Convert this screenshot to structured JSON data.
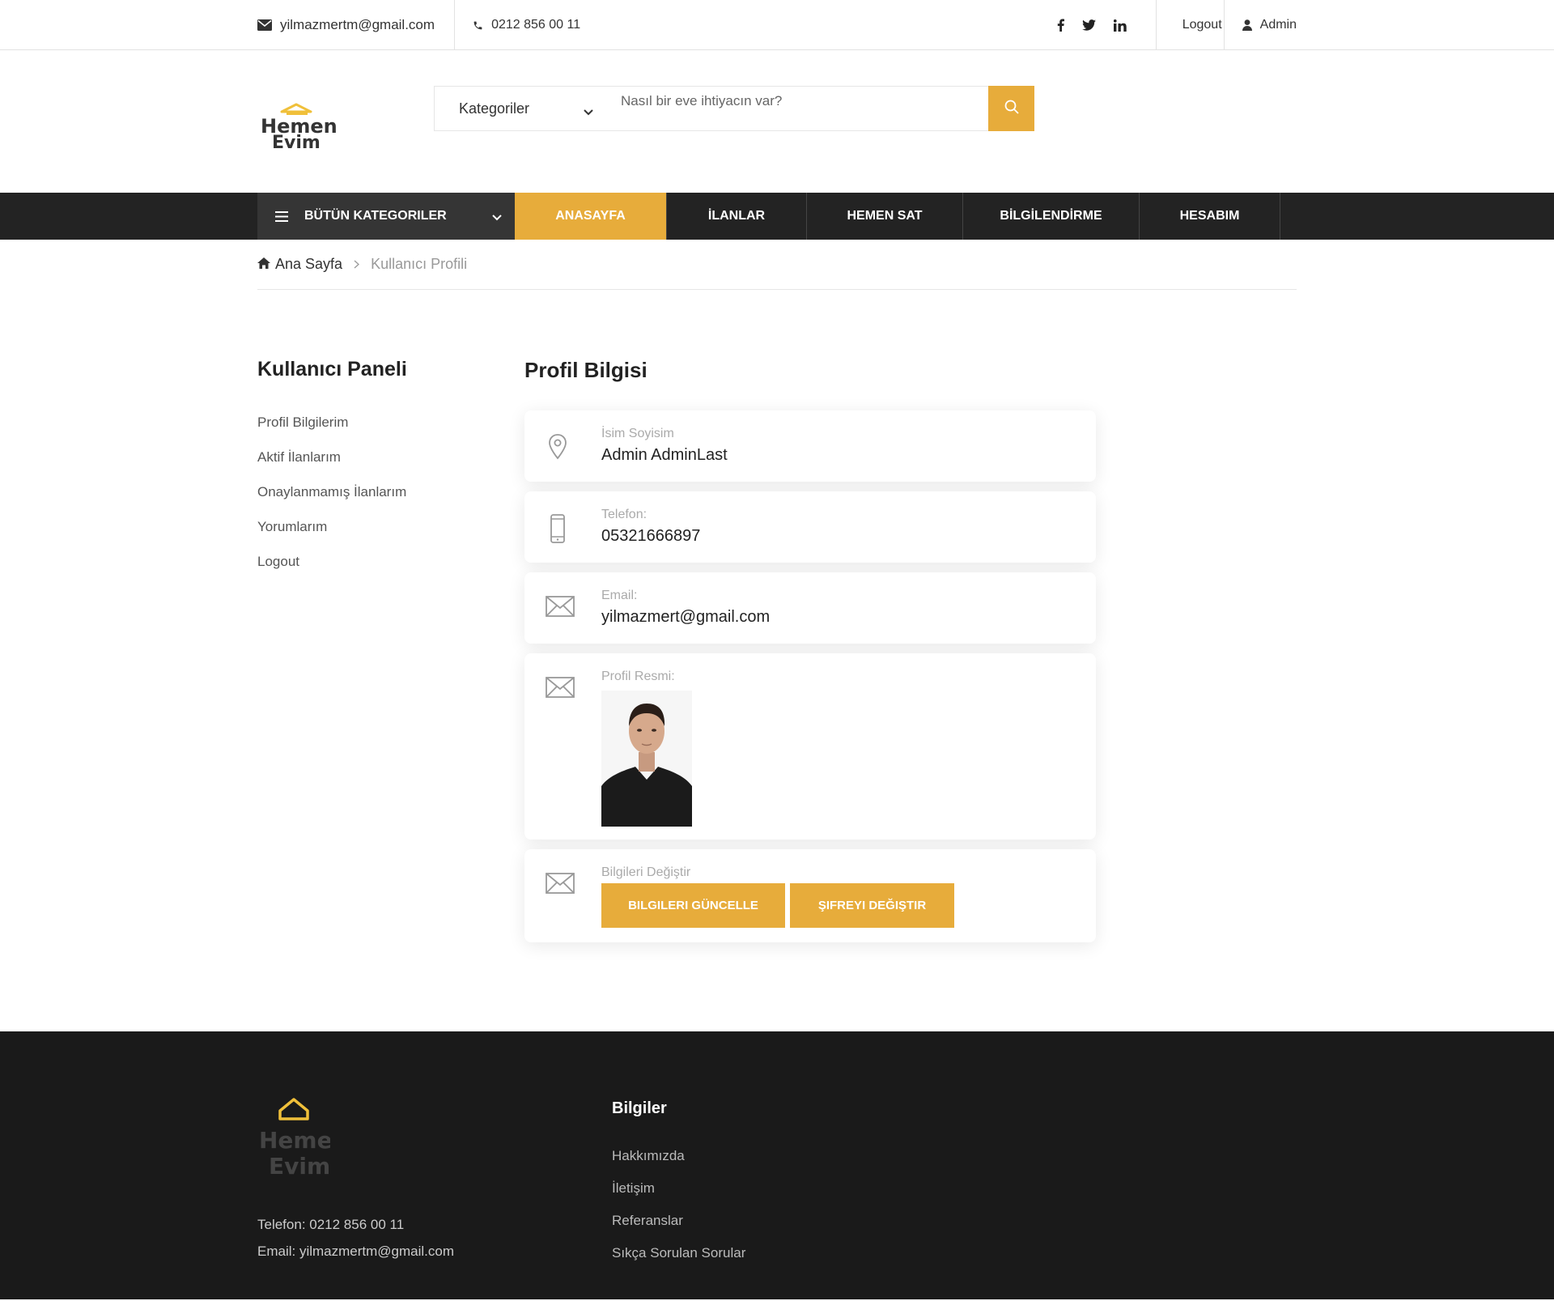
{
  "topbar": {
    "email": "yilmazmertm@gmail.com",
    "phone": "0212 856 00 11",
    "social": [
      "facebook-icon",
      "twitter-icon",
      "linkedin-icon"
    ],
    "logout": "Logout",
    "user": "Admin"
  },
  "header": {
    "logo_text": [
      "Hemen",
      "Evim"
    ],
    "search": {
      "category": "Kategoriler",
      "placeholder": "Nasıl bir eve ihtiyacın var?"
    }
  },
  "nav": {
    "all_categories": "BÜTÜN KATEGORILER",
    "items": [
      "ANASAYFA",
      "İLANLAR",
      "HEMEN SAT",
      "BİLGİLENDİRME",
      "HESABIM"
    ],
    "active": "ANASAYFA"
  },
  "breadcrumb": {
    "home": "Ana Sayfa",
    "current": "Kullanıcı Profili"
  },
  "sidebar": {
    "title": "Kullanıcı Paneli",
    "links": [
      "Profil Bilgilerim",
      "Aktif İlanlarım",
      "Onaylanmamış İlanlarım",
      "Yorumlarım",
      "Logout"
    ]
  },
  "profile": {
    "title": "Profil Bilgisi",
    "name_label": "İsim Soyisim",
    "name_value": "Admin AdminLast",
    "phone_label": "Telefon:",
    "phone_value": "05321666897",
    "email_label": "Email:",
    "email_value": "yilmazmert@gmail.com",
    "photo_label": "Profil Resmi:",
    "edit_label": "Bilgileri Değiştir",
    "update_button": "BILGILERI GÜNCELLE",
    "password_button": "ŞIFREYI DEĞIŞTIR"
  },
  "footer": {
    "logo_text": [
      "Hemen",
      "Evim"
    ],
    "phone": "Telefon: 0212 856 00 11",
    "email": "Email: yilmazmertm@gmail.com",
    "info_title": "Bilgiler",
    "info_links": [
      "Hakkımızda",
      "İletişim",
      "Referanslar",
      "Sıkça Sorulan Sorular"
    ]
  },
  "colors": {
    "accent": "#e7ac3b",
    "nav_bg": "#232323",
    "footer_bg": "#1a1a1a"
  }
}
